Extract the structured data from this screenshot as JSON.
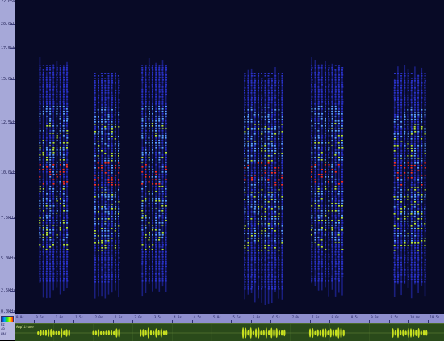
{
  "frequency_axis": {
    "labels": [
      "22.05kHz",
      "20.0kHz",
      "17.5kHz",
      "15.0kHz",
      "12.5kHz",
      "10.0kHz",
      "7.5kHz",
      "5.0kHz",
      "2.5kHz",
      "0.0kHz"
    ]
  },
  "time_axis": {
    "labels": [
      "0.0s",
      "0.5s",
      "1.0s",
      "1.5s",
      "2.0s",
      "2.5s",
      "3.0s",
      "3.5s",
      "4.0s",
      "4.5s",
      "5.0s",
      "5.5s",
      "6.0s",
      "6.5s",
      "7.0s",
      "7.5s",
      "8.0s",
      "8.5s",
      "9.0s",
      "9.5s",
      "10.0s",
      "10.5s"
    ]
  },
  "bursts": [
    {
      "start_s": 0.6,
      "end_s": 1.4
    },
    {
      "start_s": 2.0,
      "end_s": 2.7
    },
    {
      "start_s": 3.2,
      "end_s": 3.9
    },
    {
      "start_s": 5.8,
      "end_s": 6.9
    },
    {
      "start_s": 7.5,
      "end_s": 8.4
    },
    {
      "start_s": 9.6,
      "end_s": 10.5
    }
  ],
  "waveform": {
    "label": "Amplitude",
    "color": "#c8e020"
  },
  "corner": {
    "line1": "Hz",
    "line2": "dB",
    "line3": "WAV"
  },
  "colors": {
    "background": "#080a26",
    "low": "#2a32c8",
    "mid": "#5aa0ff",
    "high": "#b8e830",
    "peak": "#ff3020"
  }
}
